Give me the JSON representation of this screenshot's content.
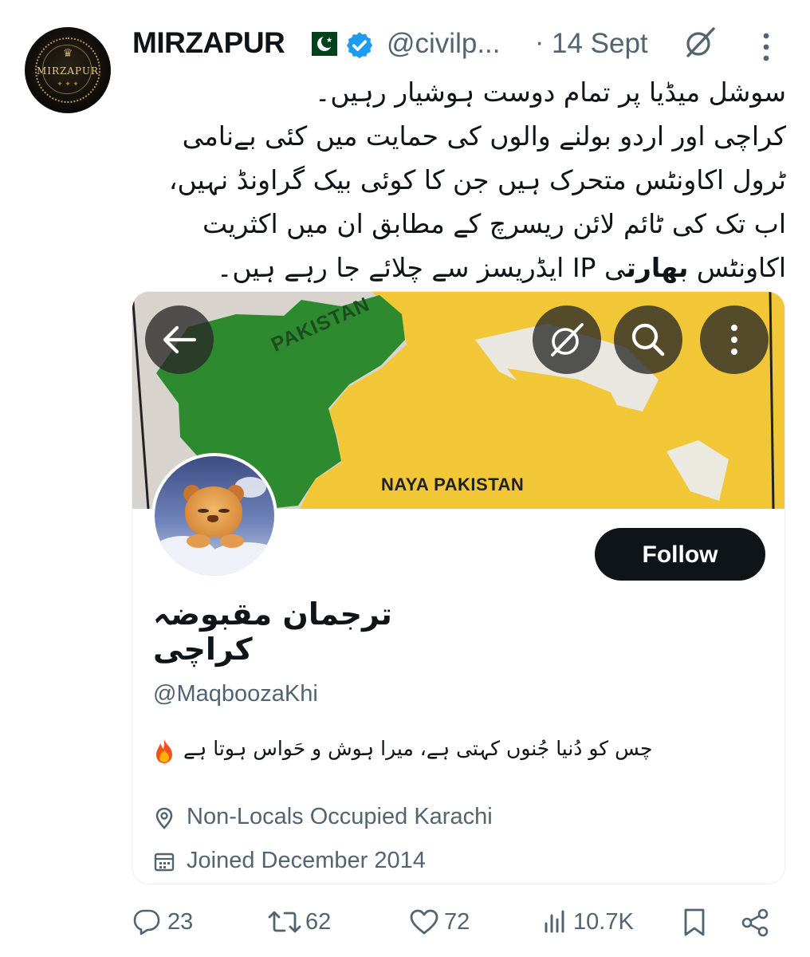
{
  "tweet": {
    "author_name": "MIRZAPUR",
    "avatar_text": "MIRZAPUR",
    "handle": "@civilp...",
    "separator": "·",
    "date": "14 Sept",
    "lines": [
      "سوشل میڈیا پر تمام دوست ہوشیار رہیں۔",
      "کراچی اور اردو بولنے والوں کی حمایت میں کئی بےنامی",
      "ٹرول اکاونٹس متحرک ہیں جن کا کوئی بیک گراونڈ نہیں،",
      "اب تک کی ٹائم لائن ریسرچ کے مطابق ان میں اکثریت"
    ],
    "last_line_start": "اکاونٹس ",
    "last_line_bold": "بھارت",
    "last_line_end": "ی IP ایڈریسز سے چلائے جا رہے ہیں۔"
  },
  "card": {
    "banner_labels": {
      "pakistan": "PAKISTAN",
      "naya": "NAYA PAKISTAN"
    },
    "follow_label": "Follow",
    "display_name": "ترجمان مقبوضہ کراچی",
    "handle": "@MaqboozaKhi",
    "bio": "چس کو دُنیا جُنوں کہتی ہے، میرا ہوش و حَواس ہوتا ہے",
    "location": "Non-Locals Occupied Karachi",
    "joined": "Joined December 2014"
  },
  "actions": {
    "replies": "23",
    "reposts": "62",
    "likes": "72",
    "views": "10.7K"
  },
  "colors": {
    "verified": "#1d9bf0",
    "muted_text": "#536471",
    "follow_bg": "#0f1419",
    "pakistan_green": "#2e8a2f",
    "map_yellow": "#f2c737"
  },
  "icons": [
    "verified-badge-icon",
    "grok-icon",
    "more-icon",
    "back-arrow-icon",
    "search-icon",
    "location-icon",
    "calendar-icon",
    "reply-icon",
    "repost-icon",
    "like-icon",
    "views-icon",
    "bookmark-icon",
    "share-icon",
    "fire-emoji-icon"
  ]
}
